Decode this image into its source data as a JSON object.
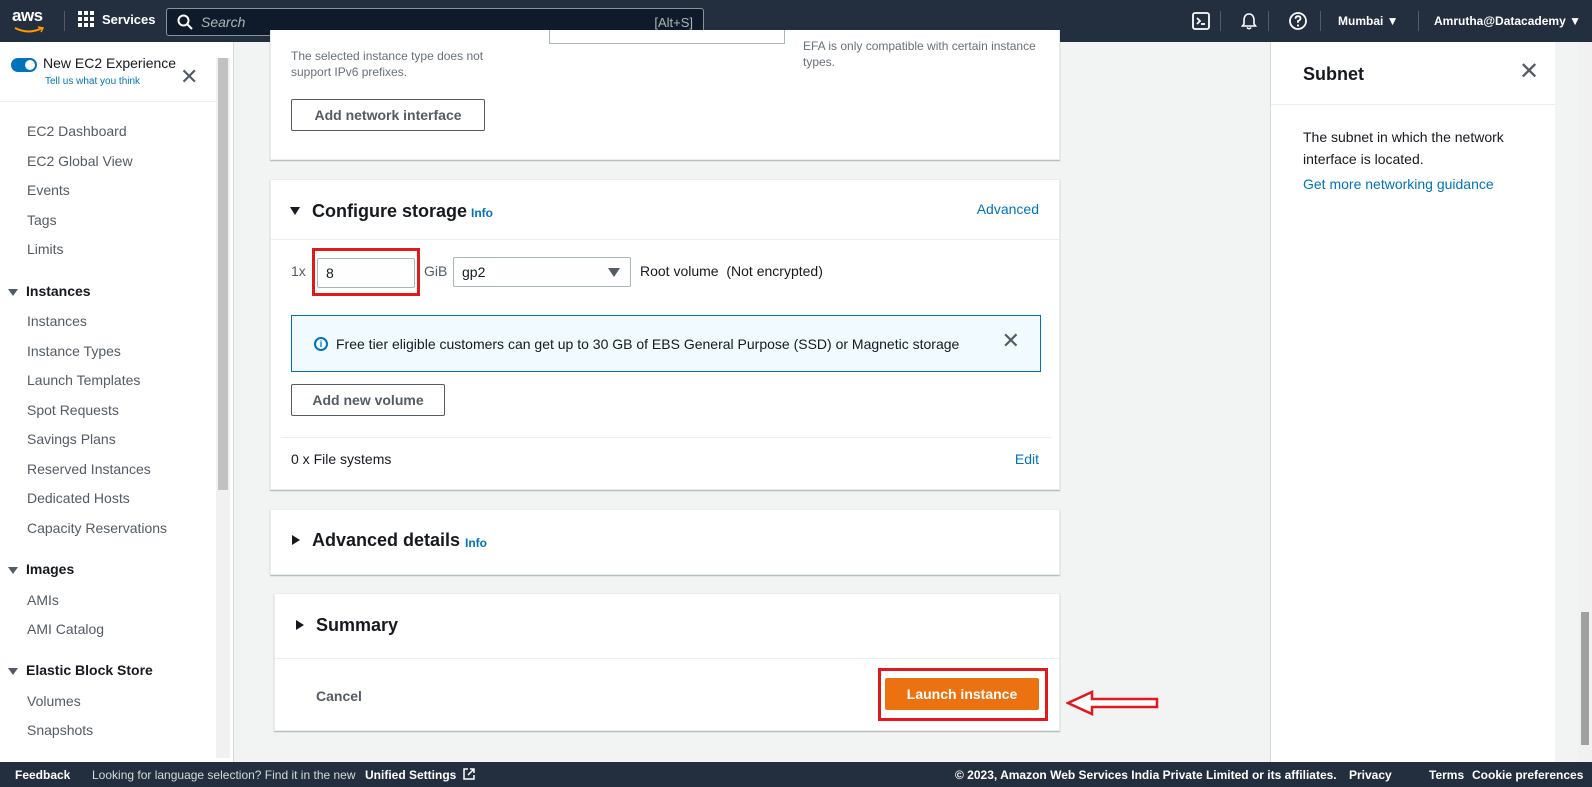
{
  "topnav": {
    "logo": "aws",
    "services_label": "Services",
    "search_placeholder": "Search",
    "search_shortcut": "[Alt+S]",
    "region": "Mumbai ▼",
    "account": "Amrutha@Datacademy ▼",
    "icons": [
      "cloudshell-icon",
      "bell-icon",
      "help-icon"
    ]
  },
  "sidebar": {
    "experience_title": "New EC2 Experience",
    "experience_link": "Tell us what you think",
    "top_items": [
      "EC2 Dashboard",
      "EC2 Global View",
      "Events",
      "Tags",
      "Limits"
    ],
    "sections": [
      {
        "title": "Instances",
        "items": [
          "Instances",
          "Instance Types",
          "Launch Templates",
          "Spot Requests",
          "Savings Plans",
          "Reserved Instances",
          "Dedicated Hosts",
          "Capacity Reservations"
        ]
      },
      {
        "title": "Images",
        "items": [
          "AMIs",
          "AMI Catalog"
        ]
      },
      {
        "title": "Elastic Block Store",
        "items": [
          "Volumes",
          "Snapshots"
        ]
      }
    ]
  },
  "network": {
    "ipv6_note": "The selected instance type does not support IPv6 prefixes.",
    "efa_note": "EFA is only compatible with certain instance types.",
    "add_interface_label": "Add network interface"
  },
  "storage": {
    "title": "Configure storage",
    "info": "Info",
    "advanced": "Advanced",
    "count": "1x",
    "size": "8",
    "unit": "GiB",
    "volume_type": "gp2",
    "root_label": "Root volume  (Not encrypted)",
    "alert_text": "Free tier eligible customers can get up to 30 GB of EBS General Purpose (SSD) or Magnetic storage",
    "add_volume_label": "Add new volume",
    "file_systems": "0 x File systems",
    "edit": "Edit"
  },
  "advanced_details": {
    "title": "Advanced details",
    "info": "Info"
  },
  "summary": {
    "title": "Summary",
    "cancel": "Cancel",
    "launch": "Launch instance"
  },
  "help": {
    "title": "Subnet",
    "body": "The subnet in which the network interface is located.",
    "link": "Get more networking guidance"
  },
  "footer": {
    "feedback": "Feedback",
    "language_note": "Looking for language selection? Find it in the new",
    "unified_settings": "Unified Settings",
    "copyright": "© 2023, Amazon Web Services India Private Limited or its affiliates.",
    "privacy": "Privacy",
    "terms": "Terms",
    "cookies": "Cookie preferences"
  },
  "colors": {
    "accent_orange": "#ec7211",
    "link_blue": "#0073bb",
    "highlight_red": "#e0191f",
    "nav_dark": "#232f3e"
  }
}
